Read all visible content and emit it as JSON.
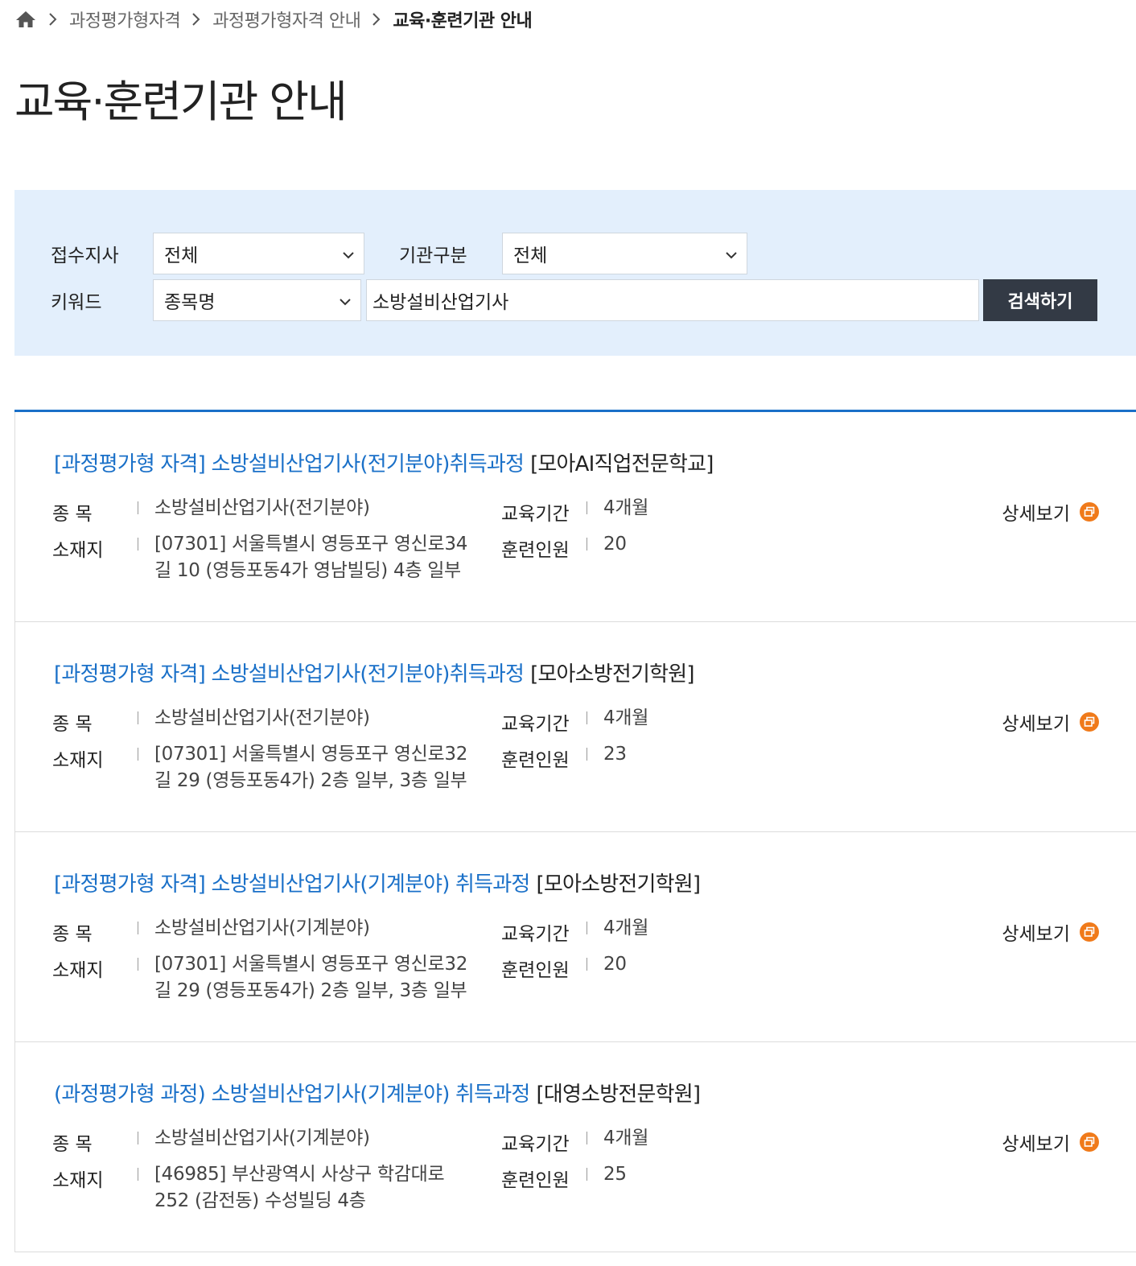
{
  "breadcrumb": {
    "items": [
      "과정평가형자격",
      "과정평가형자격 안내",
      "교육·훈련기관 안내"
    ]
  },
  "page_title": "교육·훈련기관 안내",
  "search": {
    "branch_label": "접수지사",
    "branch_value": "전체",
    "org_type_label": "기관구분",
    "org_type_value": "전체",
    "keyword_label": "키워드",
    "keyword_type_value": "종목명",
    "keyword_value": "소방설비산업기사",
    "search_button": "검색하기"
  },
  "labels": {
    "subject": "종 목",
    "location": "소재지",
    "duration": "교육기간",
    "trainees": "훈련인원",
    "detail": "상세보기"
  },
  "results": [
    {
      "course": "[과정평가형 자격] 소방설비산업기사(전기분야)취득과정",
      "org": "[모아AI직업전문학교]",
      "subject": "소방설비산업기사(전기분야)",
      "address_line1": "[07301] 서울특별시 영등포구 영신로34",
      "address_line2": "길 10 (영등포동4가 영남빌딩) 4층 일부",
      "duration": "4개월",
      "trainees": "20"
    },
    {
      "course": "[과정평가형 자격] 소방설비산업기사(전기분야)취득과정",
      "org": "[모아소방전기학원]",
      "subject": "소방설비산업기사(전기분야)",
      "address_line1": "[07301] 서울특별시 영등포구 영신로32",
      "address_line2": "길 29 (영등포동4가) 2층 일부, 3층 일부",
      "duration": "4개월",
      "trainees": "23"
    },
    {
      "course": "[과정평가형 자격] 소방설비산업기사(기계분야) 취득과정",
      "org": "[모아소방전기학원]",
      "subject": "소방설비산업기사(기계분야)",
      "address_line1": "[07301] 서울특별시 영등포구 영신로32",
      "address_line2": "길 29 (영등포동4가) 2층 일부, 3층 일부",
      "duration": "4개월",
      "trainees": "20"
    },
    {
      "course": "(과정평가형 과정) 소방설비산업기사(기계분야) 취득과정",
      "org": "[대영소방전문학원]",
      "subject": "소방설비산업기사(기계분야)",
      "address_line1": "[46985] 부산광역시 사상구 학감대로",
      "address_line2": "252 (감전동) 수성빌딩 4층",
      "duration": "4개월",
      "trainees": "25"
    }
  ],
  "colors": {
    "accent_blue": "#1a70c8",
    "search_bg": "#e3effc",
    "button_dark": "#333a45",
    "detail_icon": "#f07a1a"
  }
}
